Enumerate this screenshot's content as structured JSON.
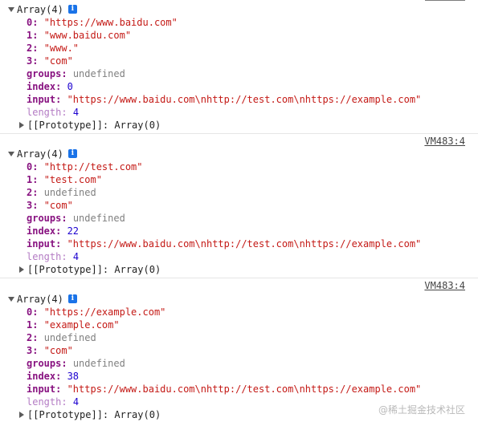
{
  "entries": [
    {
      "vm": "",
      "header": "Array(4)",
      "items": [
        {
          "key": "0",
          "value": "\"https://www.baidu.com\""
        },
        {
          "key": "1",
          "value": "\"www.baidu.com\""
        },
        {
          "key": "2",
          "value": "\"www.\""
        },
        {
          "key": "3",
          "value": "\"com\""
        }
      ],
      "groups": {
        "key": "groups",
        "value": "undefined"
      },
      "index": {
        "key": "index",
        "value": "0"
      },
      "input": {
        "key": "input",
        "value": "\"https://www.baidu.com\\nhttp://test.com\\nhttps://example.com\""
      },
      "length": {
        "key": "length",
        "value": "4"
      },
      "prototype": "[[Prototype]]: Array(0)"
    },
    {
      "vm": "VM483:4",
      "header": "Array(4)",
      "items": [
        {
          "key": "0",
          "value": "\"http://test.com\""
        },
        {
          "key": "1",
          "value": "\"test.com\""
        },
        {
          "key": "2",
          "value": "undefined"
        },
        {
          "key": "3",
          "value": "\"com\""
        }
      ],
      "groups": {
        "key": "groups",
        "value": "undefined"
      },
      "index": {
        "key": "index",
        "value": "22"
      },
      "input": {
        "key": "input",
        "value": "\"https://www.baidu.com\\nhttp://test.com\\nhttps://example.com\""
      },
      "length": {
        "key": "length",
        "value": "4"
      },
      "prototype": "[[Prototype]]: Array(0)"
    },
    {
      "vm": "VM483:4",
      "header": "Array(4)",
      "items": [
        {
          "key": "0",
          "value": "\"https://example.com\""
        },
        {
          "key": "1",
          "value": "\"example.com\""
        },
        {
          "key": "2",
          "value": "undefined"
        },
        {
          "key": "3",
          "value": "\"com\""
        }
      ],
      "groups": {
        "key": "groups",
        "value": "undefined"
      },
      "index": {
        "key": "index",
        "value": "38"
      },
      "input": {
        "key": "input",
        "value": "\"https://www.baidu.com\\nhttp://test.com\\nhttps://example.com\""
      },
      "length": {
        "key": "length",
        "value": "4"
      },
      "prototype": "[[Prototype]]: Array(0)"
    }
  ],
  "info_glyph": "i",
  "watermark": "@稀土掘金技术社区"
}
